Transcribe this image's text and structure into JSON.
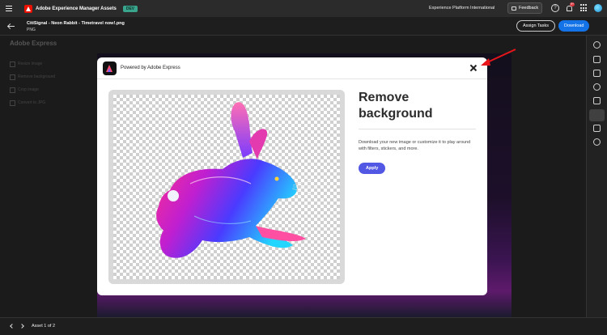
{
  "topbar": {
    "app_title": "Adobe Experience Manager Assets",
    "env_badge": "DEV",
    "org_name": "Experience Platform International",
    "feedback_label": "Feedback",
    "help_glyph": "?",
    "notification_count": "9+",
    "icons": [
      "menu-icon",
      "adobe-logo",
      "help-icon",
      "bell-icon",
      "apps-icon",
      "avatar"
    ]
  },
  "asset_header": {
    "file_name": "CitiSignal - Neon Rabbit - Timetravel now!.png",
    "file_type": "PNG",
    "assign_label": "Assign Tasks",
    "download_label": "Download"
  },
  "background": {
    "panel_title": "Adobe Express",
    "menu": [
      "Resize image",
      "Remove background",
      "Crop image",
      "Convert to JPG"
    ]
  },
  "modal": {
    "powered_by": "Powered by Adobe Express",
    "title": "Remove background",
    "description": "Download your new image or customize it to play around with filters, stickers, and more.",
    "apply_label": "Apply"
  },
  "bottombar": {
    "asset_count": "Asset 1 of 2"
  },
  "colors": {
    "accent_blue": "#1473e6",
    "apply_purple": "#5258e4",
    "env_badge_green": "#3aa58d",
    "annotation_red": "#e8161b"
  }
}
